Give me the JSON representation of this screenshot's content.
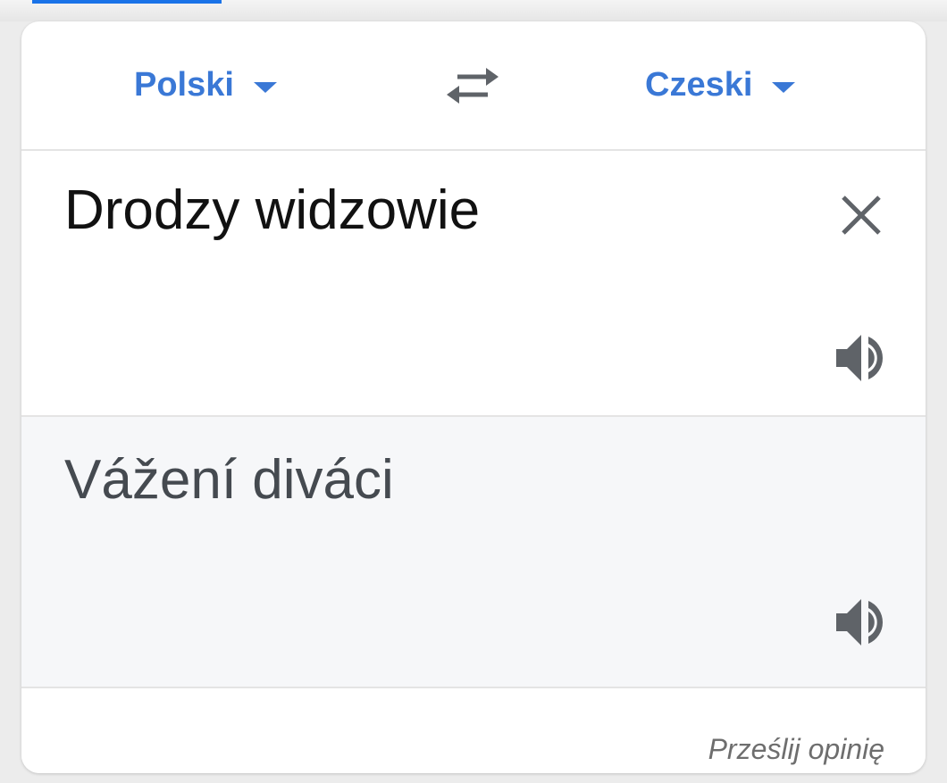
{
  "translator": {
    "source_language": "Polski",
    "target_language": "Czeski",
    "source_text": "Drodzy widzowie",
    "translated_text": "Vážení diváci",
    "feedback_link": "Prześlij opinię"
  },
  "icons": {
    "swap": "swap-languages-icon",
    "clear": "close-icon",
    "source_speaker": "speaker-icon",
    "target_speaker": "speaker-icon",
    "dropdown": "caret-down-icon"
  },
  "colors": {
    "accent": "#3a78d6",
    "output_background": "#f6f7f9",
    "icon_gray": "#5f6368"
  }
}
